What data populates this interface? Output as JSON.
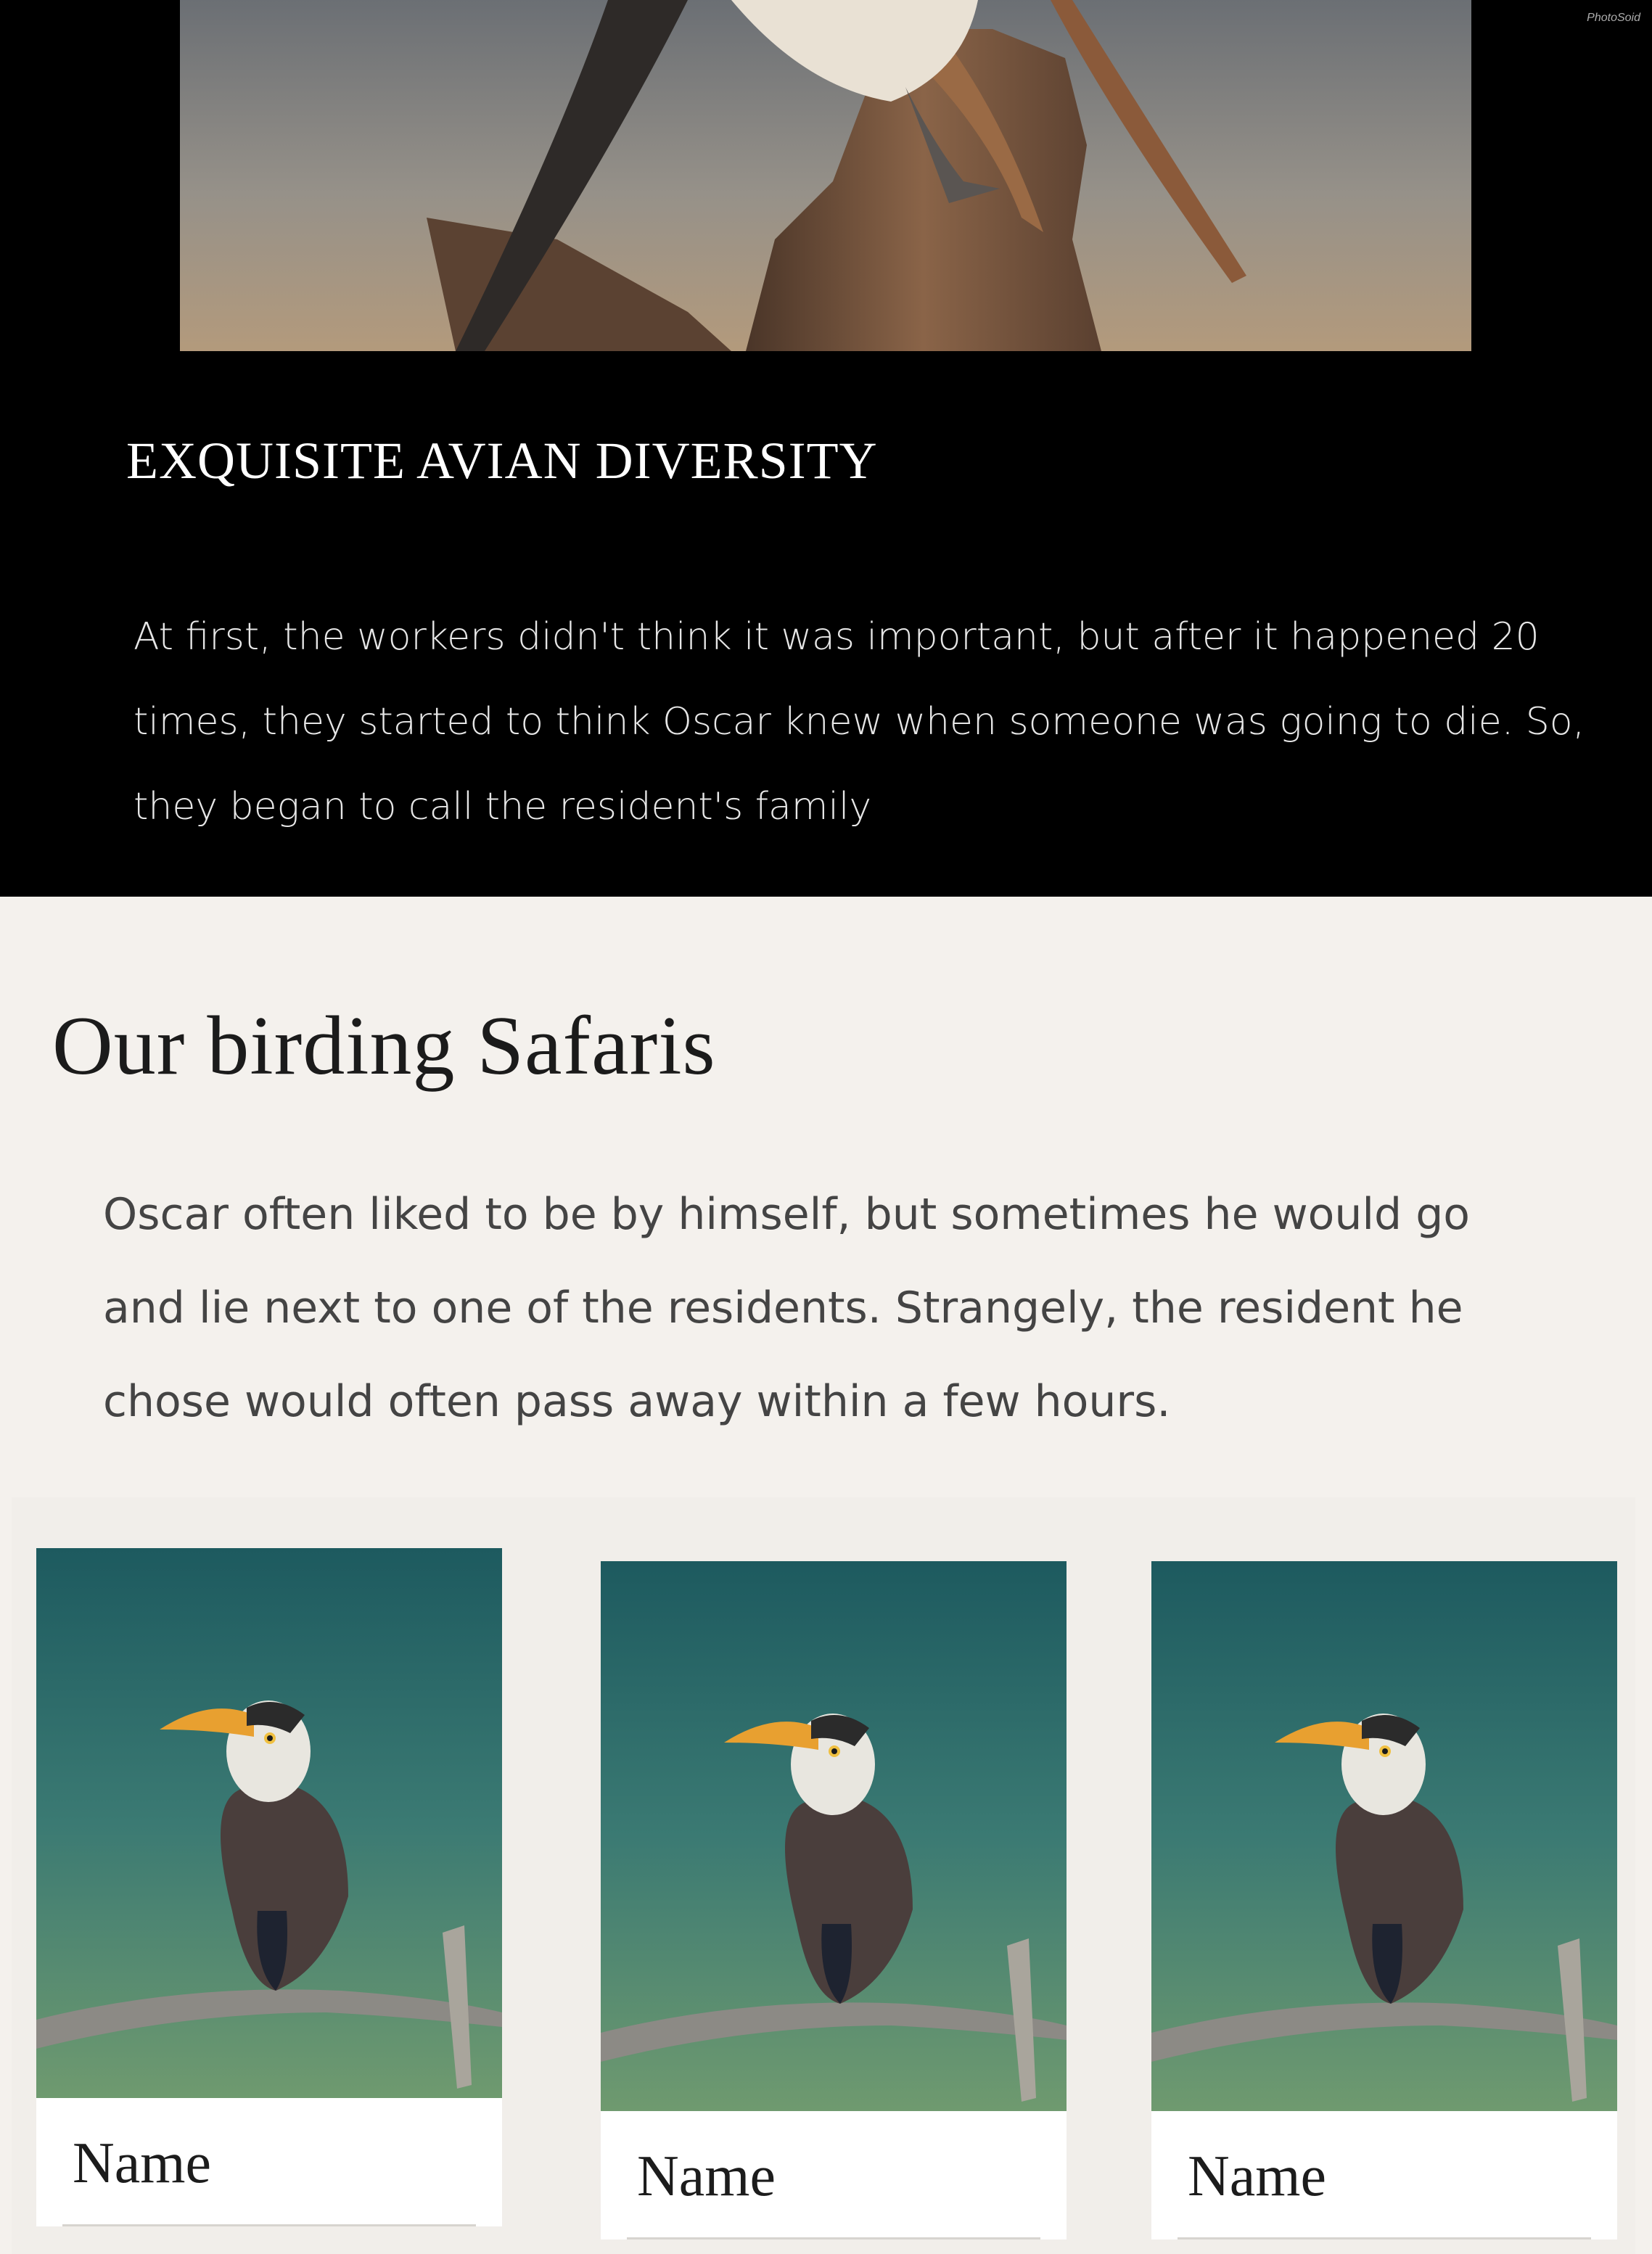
{
  "hero": {
    "watermark": "PhotoSoid",
    "title": "EXQUISITE AVIAN DIVERSITY",
    "paragraph": "At first, the workers didn't think it was important, but after it happened 20 times, they started to think Oscar knew when someone was going to die. So, they began to call the resident's family"
  },
  "section": {
    "title": "Our birding Safaris",
    "paragraph": "Oscar often liked to be by himself, but sometimes he would go and lie next to one of the residents. Strangely, the resident he chose would often pass away within a few hours."
  },
  "cards": [
    {
      "name": "Name"
    },
    {
      "name": "Name"
    },
    {
      "name": "Name"
    }
  ]
}
